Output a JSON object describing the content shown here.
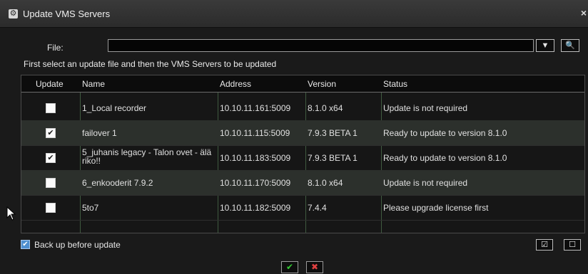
{
  "window": {
    "title": "Update VMS Servers",
    "close_glyph": "×",
    "icon": "gear-icon"
  },
  "file": {
    "label": "File:",
    "value": ""
  },
  "toolbar": {
    "filter_glyph": "▼",
    "search_glyph": "🔍"
  },
  "instructions": "First select an update file and then the VMS Servers to be updated",
  "table": {
    "headers": {
      "update": "Update",
      "name": "Name",
      "address": "Address",
      "version": "Version",
      "status": "Status"
    },
    "rows": [
      {
        "checked": "",
        "name": "1_Local recorder",
        "address": "10.10.11.161:5009",
        "version": "8.1.0 x64",
        "status": "Update is not required"
      },
      {
        "checked": "✔",
        "name": "failover 1",
        "address": "10.10.11.115:5009",
        "version": "7.9.3 BETA 1",
        "status": "Ready to update to version 8.1.0"
      },
      {
        "checked": "✔",
        "name": "5_juhanis legacy - Talon ovet - älä riko!!",
        "address": "10.10.11.183:5009",
        "version": "7.9.3 BETA 1",
        "status": "Ready to update to version 8.1.0"
      },
      {
        "checked": "",
        "name": "6_enkooderit 7.9.2",
        "address": "10.10.11.170:5009",
        "version": "8.1.0 x64",
        "status": "Update is not required"
      },
      {
        "checked": "",
        "name": "5to7",
        "address": "10.10.11.182:5009",
        "version": "7.4.4",
        "status": "Please upgrade license first"
      }
    ]
  },
  "backup": {
    "checked": "✔",
    "label": "Back up before update"
  },
  "select_buttons": {
    "select_all": "☑",
    "select_none": "☐"
  },
  "dialog_buttons": {
    "ok": "✔",
    "cancel": "✖"
  },
  "colors": {
    "background": "#1a1a1a",
    "row_alt": "#2c302c",
    "accent_blue": "#4f8fd0",
    "ok_green": "#33cc33",
    "cancel_red": "#e04040"
  }
}
